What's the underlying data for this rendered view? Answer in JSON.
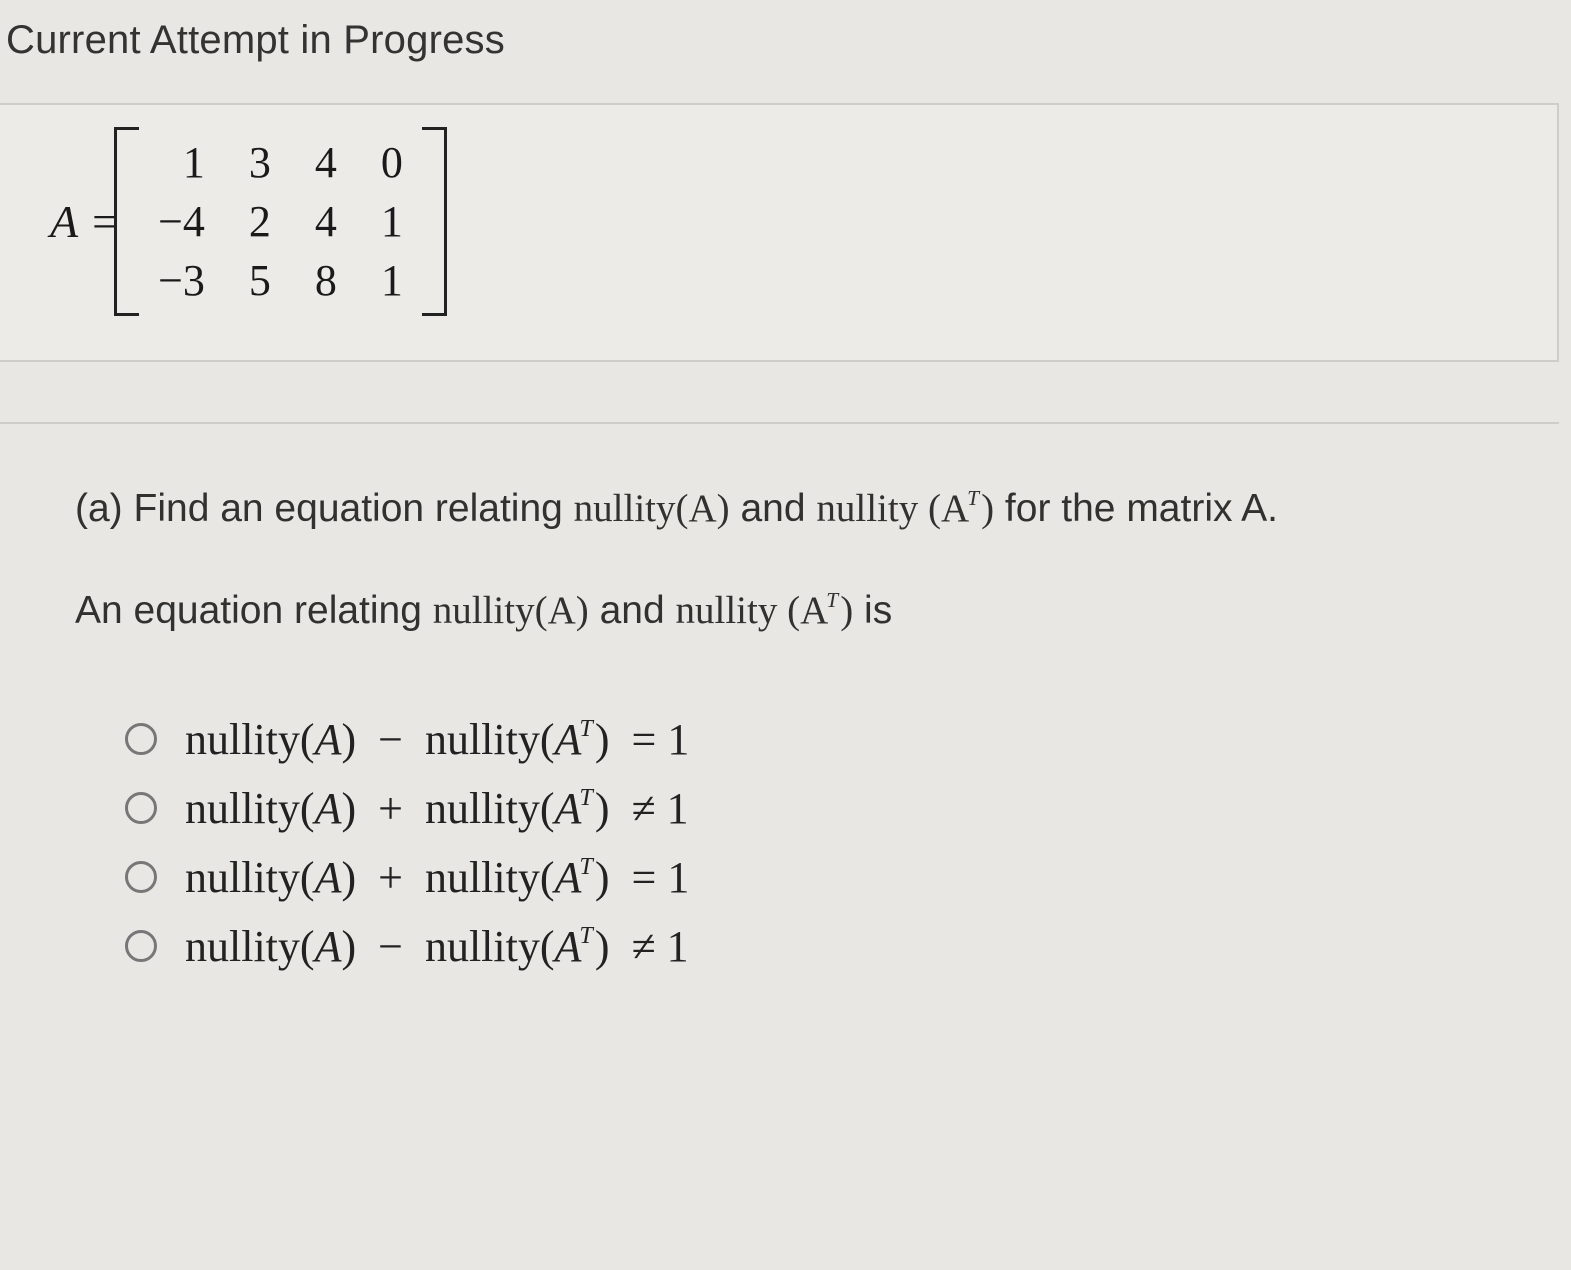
{
  "heading": "Current Attempt in Progress",
  "matrix": {
    "lhs": "A",
    "equals": "=",
    "rows": [
      [
        "1",
        "3",
        "4",
        "0"
      ],
      [
        "−4",
        "2",
        "4",
        "1"
      ],
      [
        "−3",
        "5",
        "8",
        "1"
      ]
    ]
  },
  "question": {
    "part_label": "(a)",
    "prompt_prefix": "Find an equation relating ",
    "nullity_A": "nullity(A)",
    "and_word": " and ",
    "nullity_word": "nullity ",
    "AT_open": "(A",
    "AT_sup": "T",
    "AT_close": ")",
    "prompt_suffix_1": " for the matrix A.",
    "line2_prefix": "An equation relating ",
    "line2_suffix": " is"
  },
  "options": [
    {
      "op": "−",
      "rel": "=",
      "rhs": "1"
    },
    {
      "op": "+",
      "rel": "≠",
      "rhs": "1"
    },
    {
      "op": "+",
      "rel": "=",
      "rhs": "1"
    },
    {
      "op": "−",
      "rel": "≠",
      "rhs": "1"
    }
  ],
  "option_terms": {
    "nullity_open": "nullity",
    "A_open": "(",
    "A_sym": "A",
    "A_close": ")",
    "AT_open": "(",
    "AT_sym": "A",
    "AT_sup": "T",
    "AT_close": ")"
  }
}
